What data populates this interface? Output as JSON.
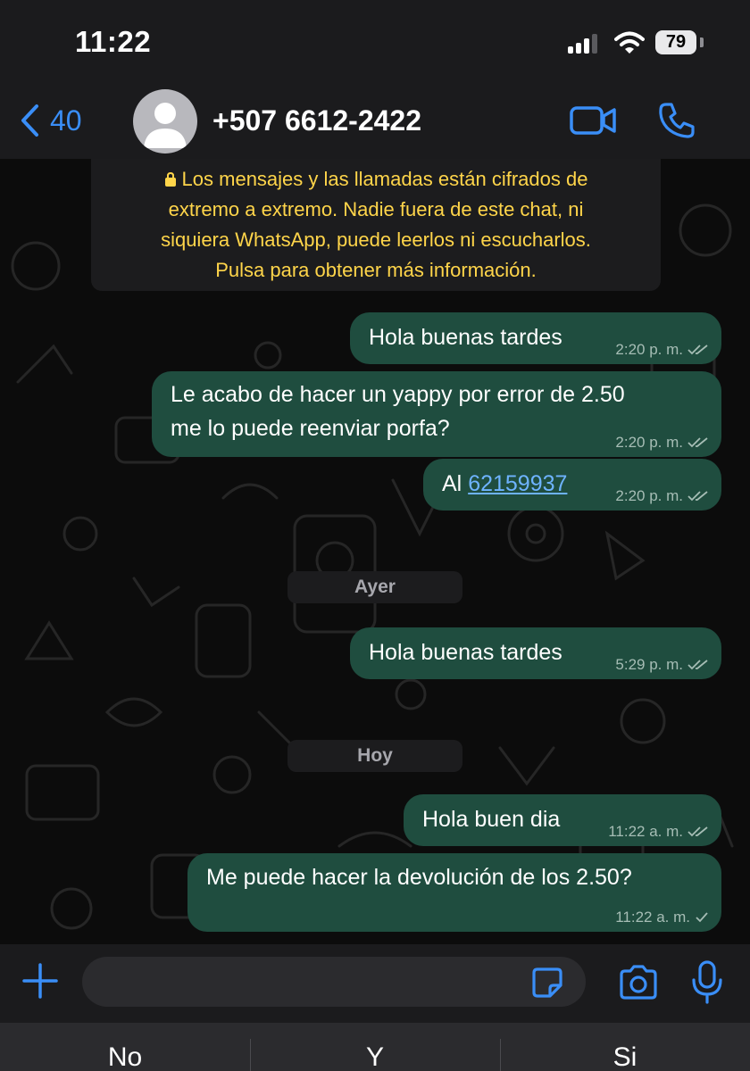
{
  "status_bar": {
    "time": "11:22",
    "battery": "79"
  },
  "header": {
    "back_count": "40",
    "contact": "+507 6612-2422"
  },
  "encryption_notice": {
    "lines": [
      "Los mensajes y las llamadas están cifrados de",
      "extremo a extremo. Nadie fuera de este chat, ni",
      "siquiera WhatsApp, puede leerlos ni escucharlos.",
      "Pulsa para obtener más información."
    ]
  },
  "messages": [
    {
      "lines": [
        "Hola buenas tardes"
      ],
      "time": "2:20 p. m.",
      "status": "read"
    },
    {
      "lines": [
        "Le acabo de hacer un yappy por error de 2.50",
        "me lo puede reenviar porfa?"
      ],
      "time": "2:20 p. m.",
      "status": "read"
    },
    {
      "prefix": "Al ",
      "link": "62159937",
      "time": "2:20 p. m.",
      "status": "read"
    },
    {
      "lines": [
        "Hola buenas tardes"
      ],
      "time": "5:29 p. m.",
      "status": "read"
    },
    {
      "lines": [
        "Hola buen dia"
      ],
      "time": "11:22 a. m.",
      "status": "read"
    },
    {
      "lines": [
        "Me puede hacer la devolución de los 2.50?"
      ],
      "time": "11:22 a. m.",
      "status": "sent"
    }
  ],
  "date_separators": [
    "Ayer",
    "Hoy"
  ],
  "input": {
    "value": "",
    "placeholder": ""
  },
  "keyboard_suggestions": [
    "No",
    "Y",
    "Si"
  ],
  "colors": {
    "accent": "#3a8ef7",
    "outgoing_bubble": "#1f4d3f",
    "notice_text": "#ffd54a",
    "link": "#6eb3ff"
  },
  "icons": [
    "back-chevron-icon",
    "avatar-icon",
    "video-icon",
    "phone-icon",
    "lock-icon",
    "double-check-icon",
    "single-check-icon",
    "plus-icon",
    "sticker-icon",
    "camera-icon",
    "mic-icon",
    "signal-icon",
    "wifi-icon",
    "battery-icon"
  ]
}
